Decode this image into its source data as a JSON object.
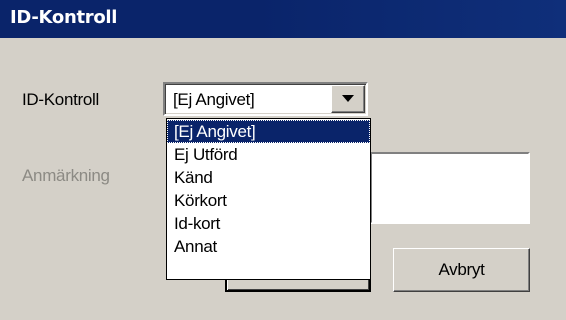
{
  "window": {
    "title": "ID-Kontroll"
  },
  "form": {
    "id_control_label": "ID-Kontroll",
    "id_control_value": "[Ej Angivet]",
    "remark_label": "Anmärkning",
    "remark_value": ""
  },
  "dropdown": {
    "options": [
      "[Ej Angivet]",
      "Ej Utförd",
      "Känd",
      "Körkort",
      "Id-kort",
      "Annat"
    ],
    "selected_index": 0
  },
  "buttons": {
    "ok_label": "",
    "cancel_label": "Avbryt"
  },
  "colors": {
    "title_bar": "#0a246a",
    "face": "#d4d0c8",
    "highlight": "#0a246a"
  }
}
